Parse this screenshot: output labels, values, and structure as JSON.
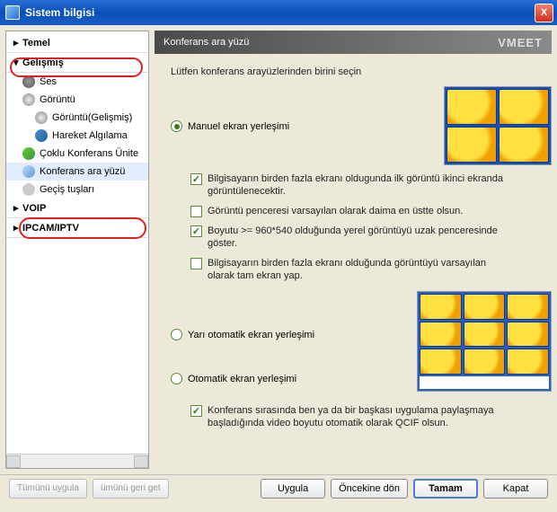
{
  "window": {
    "title": "Sistem bilgisi",
    "brand": "VMEET"
  },
  "sidebar": {
    "cat_basic": "Temel",
    "cat_adv": "Gelişmiş",
    "cat_voip": "VOIP",
    "cat_ipcam": "IPCAM/IPTV",
    "items": {
      "ses": "Ses",
      "goruntu": "Görüntü",
      "goruntu_adv": "Görüntü(Gelişmiş)",
      "hareket": "Hareket Algılama",
      "coklu": "Çoklu Konferans Ünite",
      "konferans": "Konferans ara yüzü",
      "gecis": "Geçiş tuşları"
    }
  },
  "content": {
    "header": "Konferans ara yüzü",
    "instruction": "Lütfen konferans arayüzlerinden birini seçin",
    "radio_manual": "Manuel ekran yerleşimi",
    "radio_semi": "Yarı otomatik ekran yerleşimi",
    "radio_auto": "Otomatik ekran yerleşimi",
    "chk1": "Bilgisayarın birden fazla ekranı oldugunda ilk görüntü ikinci ekranda görüntülenecektir.",
    "chk2": "Görüntü penceresi varsayılan olarak daima en üstte olsun.",
    "chk3": "Boyutu >= 960*540 olduğunda yerel görüntüyü uzak penceresinde göster.",
    "chk4": "Bilgisayarın birden fazla ekranı olduğunda görüntüyü varsayılan olarak tam ekran yap.",
    "chk5": "Konferans sırasında ben ya da bir başkası uygulama paylaşmaya başladığında video boyutu otomatik olarak QCIF olsun."
  },
  "footer": {
    "apply_all": "Tümünü uygula",
    "revert_all": "ümünü geri get",
    "apply": "Uygula",
    "previous": "Öncekine dön",
    "ok": "Tamam",
    "close": "Kapat"
  }
}
